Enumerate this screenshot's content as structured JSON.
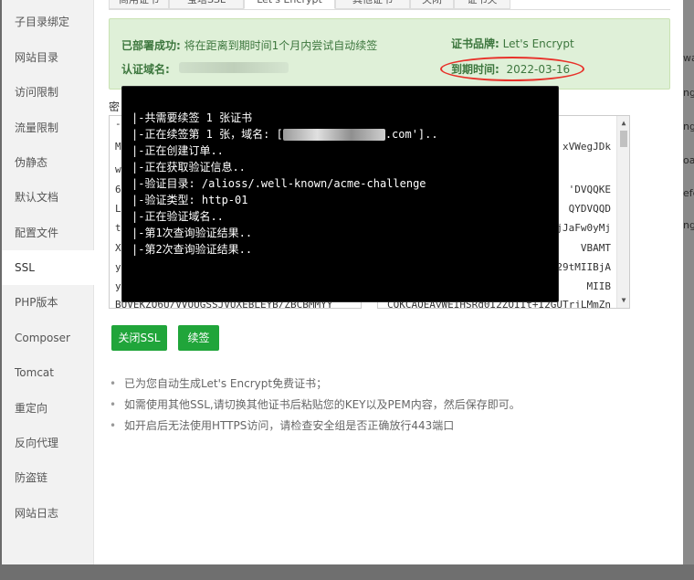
{
  "sidebar": {
    "items": [
      {
        "label": "子目录绑定",
        "active": false
      },
      {
        "label": "网站目录",
        "active": false
      },
      {
        "label": "访问限制",
        "active": false
      },
      {
        "label": "流量限制",
        "active": false
      },
      {
        "label": "伪静态",
        "active": false
      },
      {
        "label": "默认文档",
        "active": false
      },
      {
        "label": "配置文件",
        "active": false
      },
      {
        "label": "SSL",
        "active": true
      },
      {
        "label": "PHP版本",
        "active": false
      },
      {
        "label": "Composer",
        "active": false
      },
      {
        "label": "Tomcat",
        "active": false
      },
      {
        "label": "重定向",
        "active": false
      },
      {
        "label": "反向代理",
        "active": false
      },
      {
        "label": "防盗链",
        "active": false
      },
      {
        "label": "网站日志",
        "active": false
      }
    ]
  },
  "tabs": [
    {
      "label": "商用证书"
    },
    {
      "label": "宝塔SSL"
    },
    {
      "label": "Let's Encrypt"
    },
    {
      "label": "其他证书"
    },
    {
      "label": "关闭"
    },
    {
      "label": "证书夹"
    }
  ],
  "info": {
    "deploy_label": "已部署成功:",
    "deploy_text": "将在距离到期时间1个月内尝试自动续签",
    "domain_label": "认证域名:",
    "brand_label": "证书品牌:",
    "brand_value": "Let's Encrypt",
    "expire_label": "到期时间:",
    "expire_value": "2022-03-16"
  },
  "key_area": {
    "label": "密",
    "lines": [
      "--",
      "M",
      "w",
      "6\\",
      "Lt",
      "tr",
      "X",
      "yl",
      "y(",
      "BUVEKZQ6U/VVOUGSSJVUXEBLEYB/ZBCBMMYY"
    ]
  },
  "cert_area": {
    "lines": [
      "",
      "xVWegJDk",
      "",
      "'DVQQKE",
      "QYDVQQD",
      "jJaFw0yMj",
      "VBAMT",
      "29tMIIBjA",
      "MIIB",
      "CQKCAQEAyWEIHSRq0I2ZOIIt+I2GUTrjLMmZn"
    ]
  },
  "buttons": {
    "close_ssl": "关闭SSL",
    "renew": "续签"
  },
  "notes": [
    "已为您自动生成Let's Encrypt免费证书；",
    "如需使用其他SSL,请切换其他证书后粘贴您的KEY以及PEM内容，然后保存即可。",
    "如开启后无法使用HTTPS访问，请检查安全组是否正确放行443端口"
  ],
  "terminal": {
    "lines": [
      "|-共需要续签 1 张证书",
      "|-正在续签第 1 张，域名: [",
      "|-正在创建订单..",
      "|-正在获取验证信息..",
      "|-验证目录: /alioss/.well-known/acme-challenge",
      "|-验证类型: http-01",
      "|-正在验证域名..",
      "|-第1次查询验证结果..",
      "|-第2次查询验证结果.."
    ],
    "domain_suffix": ".com'].."
  },
  "background_snippets": [
    "wa",
    "ng",
    "ng",
    "oan",
    "efer",
    "ng"
  ]
}
